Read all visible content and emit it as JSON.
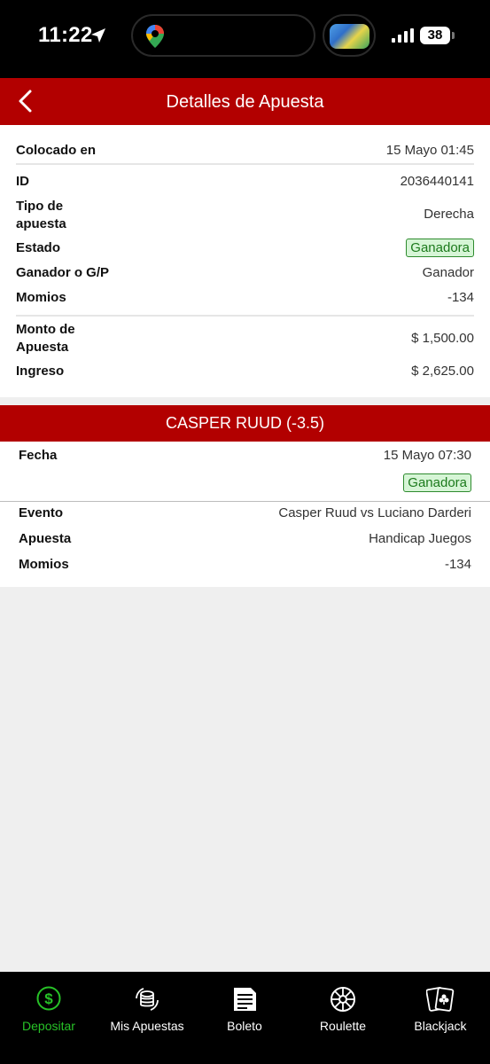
{
  "status_bar": {
    "time": "11:22",
    "battery": "38"
  },
  "header": {
    "title": "Detalles de Apuesta"
  },
  "details": {
    "placed_label": "Colocado en",
    "placed_value": "15 Mayo 01:45",
    "id_label": "ID",
    "id_value": "2036440141",
    "type_label_1": "Tipo de",
    "type_label_2": "apuesta",
    "type_value": "Derecha",
    "status_label": "Estado",
    "status_value": "Ganadora",
    "winner_label": "Ganador o G/P",
    "winner_value": "Ganador",
    "odds_label": "Momios",
    "odds_value": "-134",
    "amount_label_1": "Monto de",
    "amount_label_2": "Apuesta",
    "amount_value": "$ 1,500.00",
    "income_label": "Ingreso",
    "income_value": "$ 2,625.00"
  },
  "selection": {
    "title": "CASPER RUUD (-3.5)",
    "date_label": "Fecha",
    "date_value": "15 Mayo 07:30",
    "status_value": "Ganadora",
    "event_label": "Evento",
    "event_value": "Casper Ruud vs Luciano Darderi",
    "bet_label": "Apuesta",
    "bet_value": "Handicap Juegos",
    "odds_label": "Momios",
    "odds_value": "-134"
  },
  "tabs": [
    {
      "label": "Depositar",
      "icon": "dollar-icon",
      "active": true
    },
    {
      "label": "Mis Apuestas",
      "icon": "coins-refresh-icon",
      "active": false
    },
    {
      "label": "Boleto",
      "icon": "ticket-icon",
      "active": false
    },
    {
      "label": "Roulette",
      "icon": "roulette-icon",
      "active": false
    },
    {
      "label": "Blackjack",
      "icon": "cards-icon",
      "active": false
    }
  ],
  "colors": {
    "brand_red": "#b20000",
    "win_green": "#2e8b2e",
    "active_tab": "#27c227"
  }
}
